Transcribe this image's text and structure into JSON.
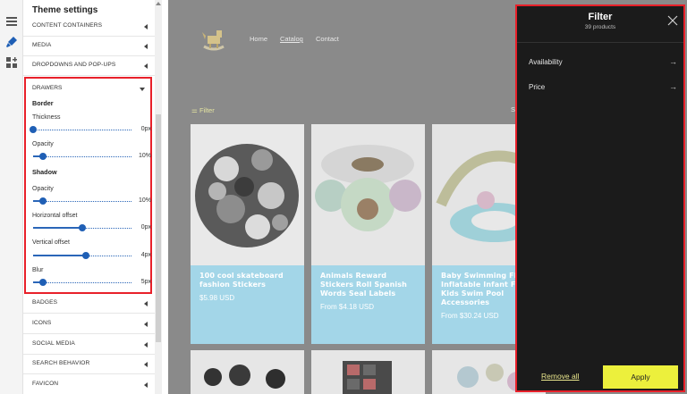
{
  "rail": {
    "icons": [
      "sections-icon",
      "theme-settings-brush-icon",
      "apps-add-icon"
    ]
  },
  "sidebar": {
    "title": "Theme settings",
    "rows_top": [
      {
        "label": "CONTENT CONTAINERS"
      },
      {
        "label": "MEDIA"
      },
      {
        "label": "DROPDOWNS AND POP-UPS"
      }
    ],
    "drawers": {
      "label": "DRAWERS",
      "border_heading": "Border",
      "shadow_heading": "Shadow",
      "settings": [
        {
          "label": "Thickness",
          "value": "0px",
          "fraction": 0.0
        },
        {
          "label": "Opacity",
          "value": "10%",
          "fraction": 0.1
        },
        {
          "label": "Opacity",
          "value": "10%",
          "fraction": 0.1
        },
        {
          "label": "Horizontal offset",
          "value": "0px",
          "fraction": 0.5
        },
        {
          "label": "Vertical offset",
          "value": "4px",
          "fraction": 0.54
        },
        {
          "label": "Blur",
          "value": "5px",
          "fraction": 0.1
        }
      ]
    },
    "rows_bottom": [
      {
        "label": "BADGES"
      },
      {
        "label": "ICONS"
      },
      {
        "label": "SOCIAL MEDIA"
      },
      {
        "label": "SEARCH BEHAVIOR"
      },
      {
        "label": "FAVICON"
      }
    ]
  },
  "store": {
    "nav": [
      {
        "label": "Home"
      },
      {
        "label": "Catalog"
      },
      {
        "label": "Contact"
      }
    ],
    "filter_label": "Filter",
    "sort_label": "S",
    "products": [
      {
        "name": "100 cool skateboard fashion Stickers",
        "price": "$5.98 USD"
      },
      {
        "name": "Animals Reward Stickers Roll Spanish Words Seal Labels",
        "price": "From $4.18 USD"
      },
      {
        "name": "Baby Swimming Float Inflatable Infant Float Kids Swim Pool Accessories",
        "price": "From $30.24 USD"
      }
    ]
  },
  "filter_drawer": {
    "title": "Filter",
    "count": "39 products",
    "items": [
      {
        "label": "Availability"
      },
      {
        "label": "Price"
      }
    ],
    "remove_all": "Remove all",
    "apply": "Apply"
  },
  "colors": {
    "highlight": "#e8202a",
    "drawer_bg": "#1b1b1b",
    "apply_bg": "#ecf03c",
    "card_info_bg": "#a3d6e8",
    "preview_overlay": "#8a8a8a"
  }
}
